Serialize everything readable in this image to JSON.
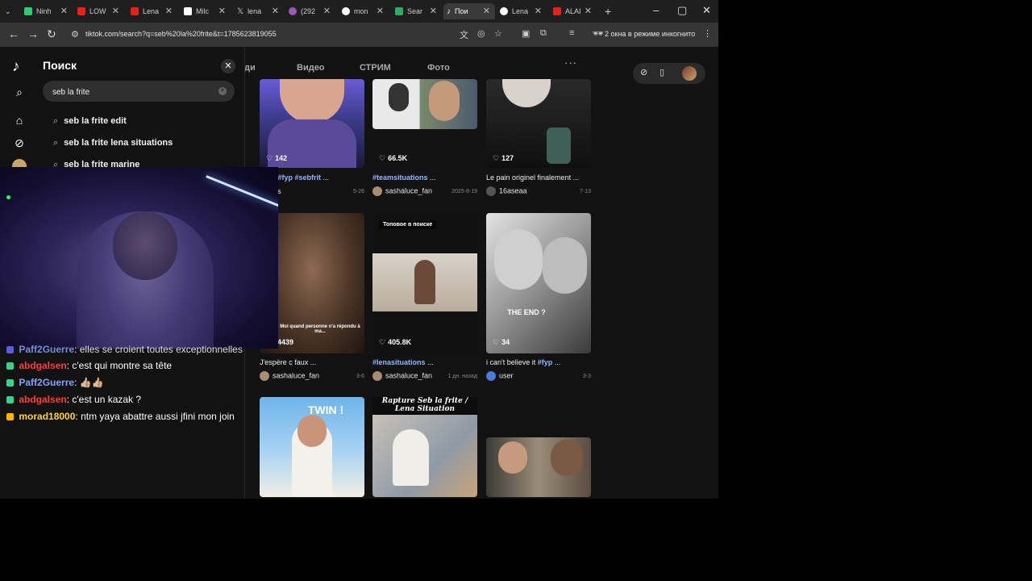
{
  "browser": {
    "tabs": [
      {
        "label": "Ninh",
        "color": "#2ecc71"
      },
      {
        "label": "LOW",
        "color": "#e62117"
      },
      {
        "label": "Lena",
        "color": "#e62117"
      },
      {
        "label": "Milc",
        "color": "#ffffff"
      },
      {
        "label": "lena",
        "color": "#000000"
      },
      {
        "label": "(292",
        "color": "#9b59b6"
      },
      {
        "label": "mon",
        "color": "#4285f4"
      },
      {
        "label": "Sear",
        "color": "#27ae60"
      },
      {
        "label": "Пои",
        "color": "#000000"
      },
      {
        "label": "Lena",
        "color": "#4285f4"
      },
      {
        "label": "ALAI",
        "color": "#e62117"
      }
    ],
    "url": "tiktok.com/search?q=seb%20la%20frite&t=1785623819055",
    "incognito_label": "2 окна в режиме инкогнито"
  },
  "search_panel": {
    "title": "Поиск",
    "query": "seb la frite",
    "suggestions": [
      "seb la frite edit",
      "seb la frite lena situations",
      "seb la frite marine"
    ]
  },
  "result_tabs": [
    "ди",
    "Видео",
    "СТРИМ",
    "Фото"
  ],
  "cards": [
    {
      "likes": "142",
      "title_plain": "",
      "title_tag": "urtoi #fyp #sebfrit",
      "title_suffix": " ...",
      "author": "pckers",
      "date": "5-26"
    },
    {
      "likes": "66.5K",
      "title_plain": "",
      "title_tag": "#teamsituations",
      "title_suffix": " ...",
      "author": "sashaluce_fan",
      "date": "2025-8-19"
    },
    {
      "likes": "127",
      "title_plain": "Le pain originel finalement ...",
      "title_tag": "",
      "title_suffix": "",
      "author": "16aseaa",
      "date": "7-13"
    },
    {
      "likes": "4439",
      "title_plain": "J'espère c faux ...",
      "title_tag": "",
      "title_suffix": "",
      "author": "sashaluce_fan",
      "date": "3-6",
      "caption": "Moi quand personne n'a répondu à ma..."
    },
    {
      "likes": "405.8K",
      "title_plain": "",
      "title_tag": "#lenasituations",
      "title_suffix": " ...",
      "author": "sashaluce_fan",
      "date": "1 дн. назад",
      "badge": "Топовое в поиске"
    },
    {
      "likes": "34",
      "title_plain": "i can't believe it ",
      "title_tag": "#fyp",
      "title_suffix": " ...",
      "author": "user",
      "date": "3-3",
      "overlay": "THE END ?"
    },
    {
      "overlay": "TWIN !"
    },
    {
      "overlay": "Rapture Seb la frite / Lena Situation"
    },
    {}
  ],
  "chat": [
    {
      "user": "Paff2Guerre",
      "msg": "elles se croient toutes exceptionnelles",
      "color": "#8aa2ff"
    },
    {
      "user": "abdgalsen",
      "msg": "c'est qui montre sa tête",
      "color": "#ff3b3b"
    },
    {
      "user": "Paff2Guerre",
      "msg": "👍🏼👍🏼",
      "color": "#8aa2ff"
    },
    {
      "user": "abdgalsen",
      "msg": "c'est un kazak ?",
      "color": "#ff3b3b"
    },
    {
      "user": "morad18000",
      "msg": "ntm yaya abattre aussi jfini mon join",
      "color": "#ffd23f"
    }
  ]
}
